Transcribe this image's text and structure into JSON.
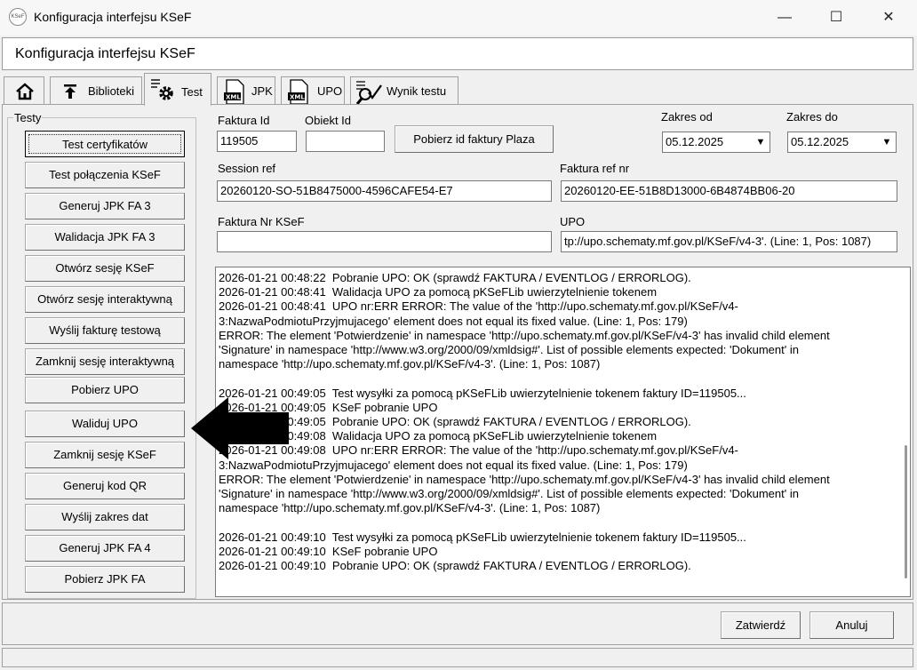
{
  "window": {
    "title": "Konfiguracja interfejsu KSeF",
    "app_icon_text": "KSeF",
    "header": "Konfiguracja interfejsu KSeF",
    "minimize": "—",
    "maximize": "☐",
    "close": "✕"
  },
  "tabs": [
    {
      "label": ""
    },
    {
      "label": "Biblioteki"
    },
    {
      "label": "Test"
    },
    {
      "label": "JPK"
    },
    {
      "label": "UPO"
    },
    {
      "label": "Wynik testu"
    }
  ],
  "testy": {
    "legend": "Testy",
    "buttons": [
      "Test certyfikatów",
      "Test połączenia KSeF",
      "Generuj JPK FA 3",
      "Walidacja JPK FA 3",
      "Otwórz sesję KSeF",
      "Otwórz sesję interaktywną",
      "Wyślij fakturę testową",
      "Zamknij sesję interaktywną",
      "Pobierz UPO",
      "Waliduj UPO",
      "Zamknij sesję KSeF",
      "Generuj kod QR",
      "Wyślij zakres dat",
      "Generuj JPK FA 4",
      "Pobierz JPK FA"
    ]
  },
  "form": {
    "faktura_id_label": "Faktura Id",
    "faktura_id_value": "119505",
    "obiekt_id_label": "Obiekt Id",
    "obiekt_id_value": "",
    "pobierz_button": "Pobierz id faktury Plaza",
    "zakres_od_label": "Zakres od",
    "zakres_od_value": "05.12.2025",
    "zakres_do_label": "Zakres do",
    "zakres_do_value": "05.12.2025",
    "session_ref_label": "Session ref",
    "session_ref_value": "20260120-SO-51B8475000-4596CAFE54-E7",
    "faktura_ref_label": "Faktura ref nr",
    "faktura_ref_value": "20260120-EE-51B8D13000-6B4874BB06-20",
    "faktura_nr_label": "Faktura Nr KSeF",
    "faktura_nr_value": "",
    "upo_label": "UPO",
    "upo_value": "tp://upo.schematy.mf.gov.pl/KSeF/v4-3'. (Line: 1, Pos: 1087)"
  },
  "log": [
    "2026-01-21 00:48:22  Pobranie UPO: OK (sprawdź FAKTURA / EVENTLOG / ERRORLOG).",
    "2026-01-21 00:48:41  Walidacja UPO za pomocą pKSeFLib uwierzytelnienie tokenem",
    "2026-01-21 00:48:41  UPO nr:ERR ERROR: The value of the 'http://upo.schematy.mf.gov.pl/KSeF/v4-",
    "3:NazwaPodmiotuPrzyjmujacego' element does not equal its fixed value. (Line: 1, Pos: 179)",
    "ERROR: The element 'Potwierdzenie' in namespace 'http://upo.schematy.mf.gov.pl/KSeF/v4-3' has invalid child element",
    "'Signature' in namespace 'http://www.w3.org/2000/09/xmldsig#'. List of possible elements expected: 'Dokument' in",
    "namespace 'http://upo.schematy.mf.gov.pl/KSeF/v4-3'. (Line: 1, Pos: 1087)",
    "",
    "2026-01-21 00:49:05  Test wysyłki za pomocą pKSeFLib uwierzytelnienie tokenem faktury ID=119505...",
    "2026-01-21 00:49:05  KSeF pobranie UPO",
    "2026-01-21 00:49:05  Pobranie UPO: OK (sprawdź FAKTURA / EVENTLOG / ERRORLOG).",
    "2026-01-21 00:49:08  Walidacja UPO za pomocą pKSeFLib uwierzytelnienie tokenem",
    "2026-01-21 00:49:08  UPO nr:ERR ERROR: The value of the 'http://upo.schematy.mf.gov.pl/KSeF/v4-",
    "3:NazwaPodmiotuPrzyjmujacego' element does not equal its fixed value. (Line: 1, Pos: 179)",
    "ERROR: The element 'Potwierdzenie' in namespace 'http://upo.schematy.mf.gov.pl/KSeF/v4-3' has invalid child element",
    "'Signature' in namespace 'http://www.w3.org/2000/09/xmldsig#'. List of possible elements expected: 'Dokument' in",
    "namespace 'http://upo.schematy.mf.gov.pl/KSeF/v4-3'. (Line: 1, Pos: 1087)",
    "",
    "2026-01-21 00:49:10  Test wysyłki za pomocą pKSeFLib uwierzytelnienie tokenem faktury ID=119505...",
    "2026-01-21 00:49:10  KSeF pobranie UPO",
    "2026-01-21 00:49:10  Pobranie UPO: OK (sprawdź FAKTURA / EVENTLOG / ERRORLOG)."
  ],
  "footer": {
    "zatwierdz": "Zatwierdź",
    "anuluj": "Anuluj"
  },
  "icons": {
    "home": "home-icon",
    "biblioteki": "upload-arrow-icon",
    "test": "gear-list-icon",
    "jpk": "xml-doc-icon",
    "upo": "xml-doc-icon",
    "wynik": "magnifier-check-icon",
    "annotation": "left-arrow-icon"
  },
  "colors": {
    "window_bg": "#f0f0f0",
    "field_bg": "#ffffff",
    "arrow": "#000000"
  }
}
